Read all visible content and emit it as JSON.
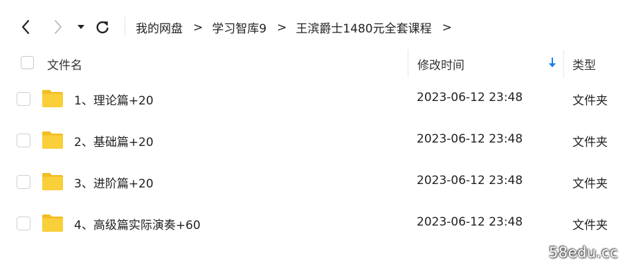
{
  "toolbar": {
    "back_icon": "chevron-left-icon",
    "forward_icon": "chevron-right-icon",
    "dropdown_icon": "caret-down-icon",
    "refresh_icon": "refresh-icon"
  },
  "breadcrumb": {
    "items": [
      "我的网盘",
      "学习智库9",
      "王滨爵士1480元全套课程"
    ],
    "separator": ">"
  },
  "columns": {
    "name": "文件名",
    "modified": "修改时间",
    "type": "类型",
    "sort_icon": "arrow-down-icon",
    "sort_color": "#1a7ee8"
  },
  "files": [
    {
      "name": "1、理论篇+20",
      "modified": "2023-06-12 23:48",
      "type": "文件夹",
      "icon": "folder-icon"
    },
    {
      "name": "2、基础篇+20",
      "modified": "2023-06-12 23:48",
      "type": "文件夹",
      "icon": "folder-icon"
    },
    {
      "name": "3、进阶篇+20",
      "modified": "2023-06-12 23:48",
      "type": "文件夹",
      "icon": "folder-icon"
    },
    {
      "name": "4、高级篇实际演奏+60",
      "modified": "2023-06-12 23:48",
      "type": "文件夹",
      "icon": "folder-icon"
    }
  ],
  "colors": {
    "folder": "#f9cf3a",
    "folder_back": "#f3bd22"
  },
  "watermark": "58edu.cc"
}
